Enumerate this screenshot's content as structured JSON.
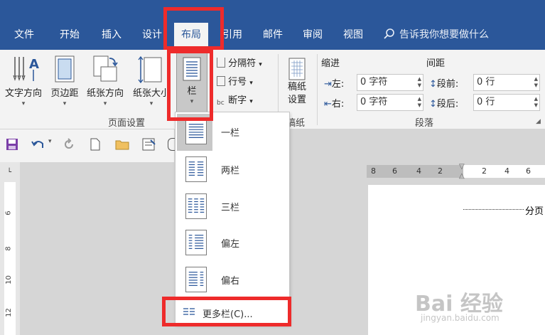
{
  "tabs": [
    {
      "label": "文件",
      "active": false
    },
    {
      "label": "开始",
      "active": false
    },
    {
      "label": "插入",
      "active": false
    },
    {
      "label": "设计",
      "active": false
    },
    {
      "label": "布局",
      "active": true
    },
    {
      "label": "引用",
      "active": false
    },
    {
      "label": "邮件",
      "active": false
    },
    {
      "label": "审阅",
      "active": false
    },
    {
      "label": "视图",
      "active": false
    }
  ],
  "tell_me": "告诉我你想要做什么",
  "ribbon": {
    "page_setup": {
      "text_direction": "文字方向",
      "margins": "页边距",
      "orientation": "纸张方向",
      "size": "纸张大小",
      "columns": "栏",
      "breaks": "分隔符",
      "line_numbers": "行号",
      "hyphenation": "断字",
      "group_label": "页面设置"
    },
    "manuscript": {
      "settings": "稿纸设置",
      "settings_line1": "稿纸",
      "settings_line2": "设置",
      "group_label": "稿纸"
    },
    "paragraph": {
      "indent_title": "缩进",
      "spacing_title": "间距",
      "left_label": "左:",
      "left_value": "0 字符",
      "right_label": "右:",
      "right_value": "0 字符",
      "before_label": "段前:",
      "before_value": "0 行",
      "after_label": "段后:",
      "after_value": "0 行",
      "group_label": "段落"
    }
  },
  "columns_menu": {
    "items": [
      {
        "label": "一栏",
        "selected": true,
        "icon": "one-column-icon"
      },
      {
        "label": "两栏",
        "selected": false,
        "icon": "two-columns-icon"
      },
      {
        "label": "三栏",
        "selected": false,
        "icon": "three-columns-icon"
      },
      {
        "label": "偏左",
        "selected": false,
        "icon": "left-column-icon"
      },
      {
        "label": "偏右",
        "selected": false,
        "icon": "right-column-icon"
      }
    ],
    "more": "更多栏(C)..."
  },
  "ruler": {
    "vertical_ticks": [
      "6",
      "8",
      "10",
      "12"
    ],
    "horizontal_ticks": [
      "8",
      "6",
      "4",
      "2",
      "2",
      "4",
      "6"
    ]
  },
  "document": {
    "break_text": "分页"
  },
  "watermark": {
    "brand": "Bai 经验",
    "url": "jingyan.baidu.com"
  },
  "colors": {
    "accent": "#2b579a",
    "highlight": "#ee2b2b"
  }
}
